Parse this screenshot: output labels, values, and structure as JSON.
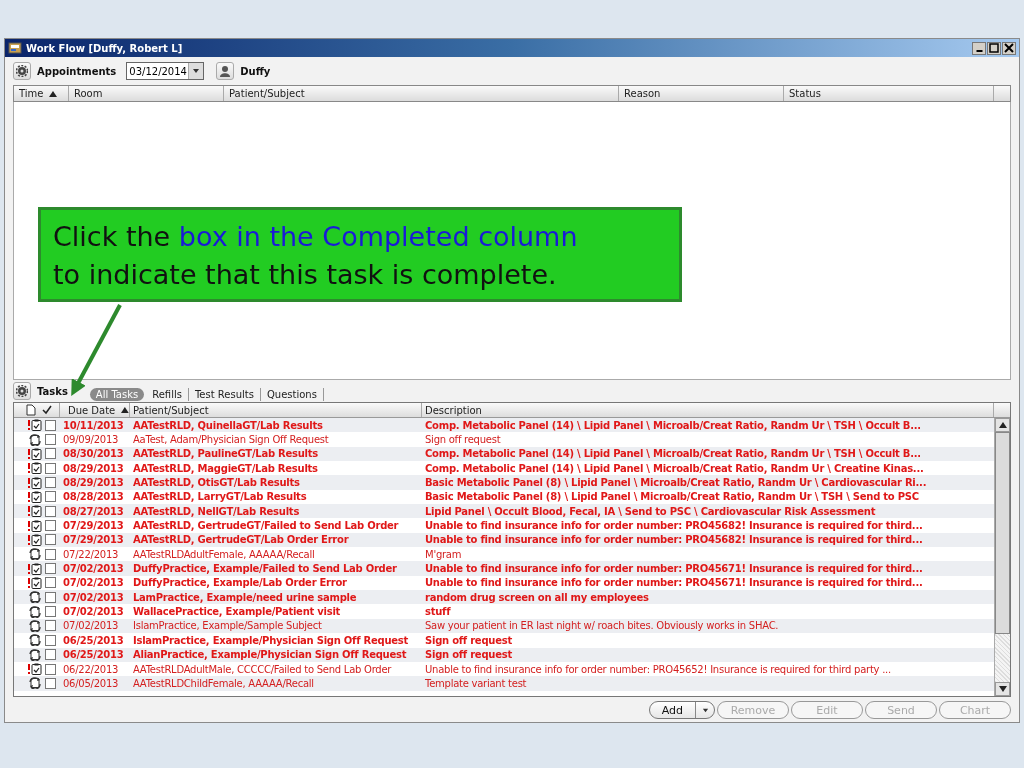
{
  "window": {
    "title": "Work Flow [Duffy, Robert L]"
  },
  "appointments": {
    "label": "Appointments",
    "date": "03/12/2014",
    "provider": "Duffy",
    "columns": [
      {
        "label": "Time",
        "sorted": true
      },
      {
        "label": "Room",
        "sorted": false
      },
      {
        "label": "Patient/Subject",
        "sorted": false
      },
      {
        "label": "Reason",
        "sorted": false
      },
      {
        "label": "Status",
        "sorted": false
      }
    ]
  },
  "callout": {
    "lines": [
      [
        {
          "text": "Click the ",
          "highlight": false
        },
        {
          "text": "box in the Completed column",
          "highlight": true
        }
      ],
      [
        {
          "text": "to indicate that this task is complete.",
          "highlight": false
        }
      ]
    ]
  },
  "tasks": {
    "label": "Tasks",
    "tabs": [
      {
        "label": "All Tasks",
        "selected": true
      },
      {
        "label": "Refills",
        "selected": false
      },
      {
        "label": "Test Results",
        "selected": false
      },
      {
        "label": "Questions",
        "selected": false
      }
    ],
    "columns": [
      {
        "label": "Due Date",
        "sorted": true
      },
      {
        "label": "Patient/Subject",
        "sorted": false
      },
      {
        "label": "Description",
        "sorted": false
      }
    ],
    "rows": [
      {
        "kind": "alert",
        "bold": true,
        "completed": false,
        "date": "10/11/2013",
        "subject": "AATestRLD, QuinellaGT/Lab Results",
        "description": "Comp. Metabolic Panel (14) \\ Lipid Panel \\ Microalb/Creat Ratio, Randm Ur \\ TSH \\ Occult B..."
      },
      {
        "kind": "cycle",
        "bold": false,
        "completed": false,
        "date": "09/09/2013",
        "subject": "AaTest, Adam/Physician Sign Off Request",
        "description": "Sign off request"
      },
      {
        "kind": "alert",
        "bold": true,
        "completed": false,
        "date": "08/30/2013",
        "subject": "AATestRLD, PaulineGT/Lab Results",
        "description": "Comp. Metabolic Panel (14) \\ Lipid Panel \\ Microalb/Creat Ratio, Randm Ur \\ TSH \\ Occult B..."
      },
      {
        "kind": "alert",
        "bold": true,
        "completed": false,
        "date": "08/29/2013",
        "subject": "AATestRLD, MaggieGT/Lab Results",
        "description": "Comp. Metabolic Panel (14) \\ Lipid Panel \\ Microalb/Creat Ratio, Randm Ur \\ Creatine Kinas..."
      },
      {
        "kind": "alert",
        "bold": true,
        "completed": false,
        "date": "08/29/2013",
        "subject": "AATestRLD, OtisGT/Lab Results",
        "description": "Basic Metabolic Panel (8) \\ Lipid Panel \\ Microalb/Creat Ratio, Randm Ur \\ Cardiovascular Ri..."
      },
      {
        "kind": "alert",
        "bold": true,
        "completed": false,
        "date": "08/28/2013",
        "subject": "AATestRLD, LarryGT/Lab Results",
        "description": "Basic Metabolic Panel (8) \\ Lipid Panel \\ Microalb/Creat Ratio, Randm Ur \\ TSH \\ Send to PSC"
      },
      {
        "kind": "alert",
        "bold": true,
        "completed": false,
        "date": "08/27/2013",
        "subject": "AATestRLD, NellGT/Lab Results",
        "description": "Lipid Panel \\ Occult Blood, Fecal, IA \\ Send to PSC \\ Cardiovascular Risk Assessment"
      },
      {
        "kind": "alert",
        "bold": true,
        "completed": false,
        "date": "07/29/2013",
        "subject": "AATestRLD, GertrudeGT/Failed to Send Lab Order",
        "description": "Unable to find insurance info for order number: PRO45682!  Insurance is required for third..."
      },
      {
        "kind": "alert",
        "bold": true,
        "completed": false,
        "date": "07/29/2013",
        "subject": "AATestRLD, GertrudeGT/Lab Order Error",
        "description": "Unable to find insurance info for order number: PRO45682!  Insurance is required for third..."
      },
      {
        "kind": "cycle",
        "bold": false,
        "completed": false,
        "date": "07/22/2013",
        "subject": "AATestRLDAdultFemale, AAAAA/Recall",
        "description": "M'gram"
      },
      {
        "kind": "alert",
        "bold": true,
        "completed": false,
        "date": "07/02/2013",
        "subject": "DuffyPractice, Example/Failed to Send Lab Order",
        "description": "Unable to find insurance info for order number: PRO45671!  Insurance is required for third..."
      },
      {
        "kind": "alert",
        "bold": true,
        "completed": false,
        "date": "07/02/2013",
        "subject": "DuffyPractice, Example/Lab Order Error",
        "description": "Unable to find insurance info for order number: PRO45671!  Insurance is required for third..."
      },
      {
        "kind": "cycle",
        "bold": true,
        "completed": false,
        "date": "07/02/2013",
        "subject": "LamPractice, Example/need urine sample",
        "description": "random drug screen on all my employees"
      },
      {
        "kind": "cycle",
        "bold": true,
        "completed": false,
        "date": "07/02/2013",
        "subject": "WallacePractice, Example/Patient visit",
        "description": "stuff"
      },
      {
        "kind": "cycle",
        "bold": false,
        "completed": false,
        "date": "07/02/2013",
        "subject": "IslamPractice, Example/Sample Subject",
        "description": "Saw your patient in ER last night w/ roach bites. Obviously works in SHAC."
      },
      {
        "kind": "cycle",
        "bold": true,
        "completed": false,
        "date": "06/25/2013",
        "subject": "IslamPractice, Example/Physician Sign Off Request",
        "description": "Sign off request"
      },
      {
        "kind": "cycle",
        "bold": true,
        "completed": false,
        "date": "06/25/2013",
        "subject": "AlianPractice, Example/Physician Sign Off Request",
        "description": "Sign off request"
      },
      {
        "kind": "alert",
        "bold": false,
        "completed": false,
        "date": "06/22/2013",
        "subject": "AATestRLDAdultMale, CCCCC/Failed to Send Lab Order",
        "description": "Unable to find insurance info for order number: PRO45652!  Insurance is required for third party ..."
      },
      {
        "kind": "cycle",
        "bold": false,
        "completed": false,
        "date": "06/05/2013",
        "subject": "AATestRLDChildFemale, AAAAA/Recall",
        "description": "Template variant test"
      }
    ]
  },
  "buttons": [
    {
      "label": "Add",
      "kind": "split",
      "disabled": false
    },
    {
      "label": "Remove",
      "kind": "plain",
      "disabled": true
    },
    {
      "label": "Edit",
      "kind": "plain",
      "disabled": true
    },
    {
      "label": "Send",
      "kind": "plain",
      "disabled": true
    },
    {
      "label": "Chart",
      "kind": "plain",
      "disabled": true
    }
  ]
}
